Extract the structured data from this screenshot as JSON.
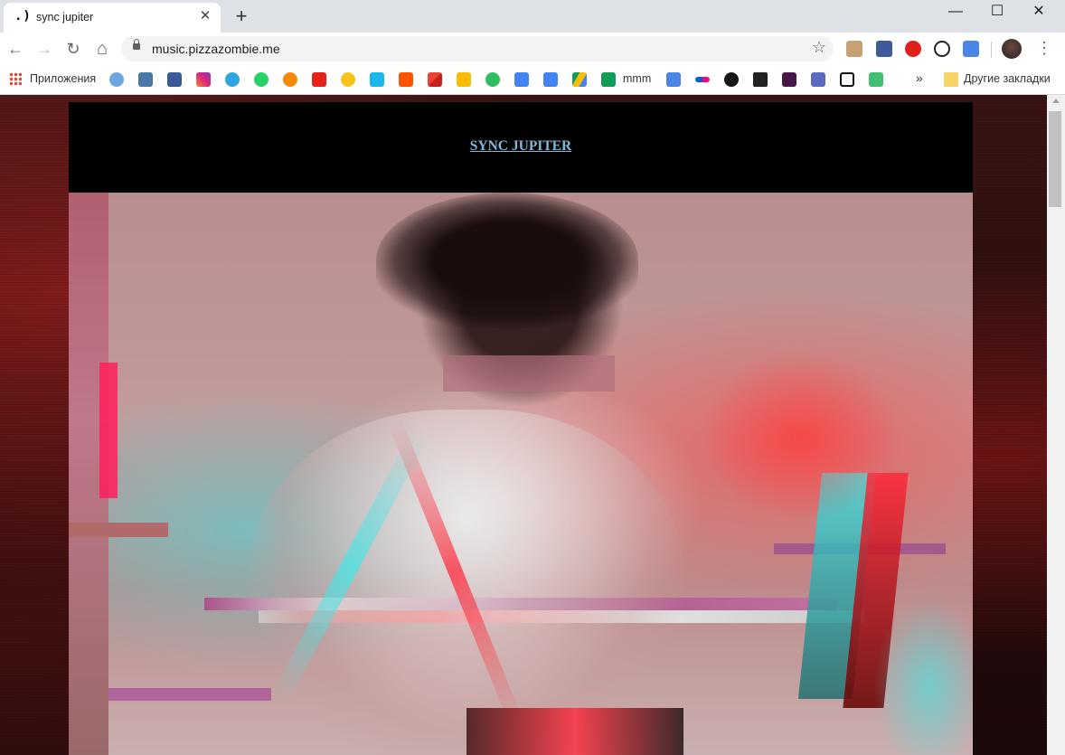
{
  "browser": {
    "tab": {
      "favicon": ".)",
      "title": "sync jupiter",
      "close": "✕"
    },
    "new_tab": "+",
    "window_controls": {
      "minimize": "—",
      "maximize": "☐",
      "close": "✕"
    },
    "nav": {
      "back": "←",
      "forward": "→",
      "reload": "↻",
      "home": "⌂"
    },
    "address": {
      "url": "music.pizzazombie.me",
      "star": "☆"
    },
    "menu": "⋮"
  },
  "bookmarks": {
    "apps_label": "Приложения",
    "mmm_label": "mmm",
    "more": "»",
    "other_label": "Другие закладки"
  },
  "page": {
    "site_title": "SYNC JUPITER"
  },
  "colors": {
    "link": "#7fb8d8",
    "header_bg": "#000000",
    "glitch_red": "#ff2a3a",
    "glitch_cyan": "#3ee8e8"
  }
}
